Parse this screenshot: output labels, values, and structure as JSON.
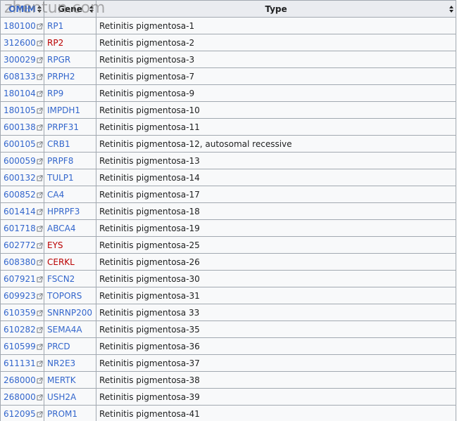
{
  "headers": {
    "omim": "OMIM",
    "gene": "Gene",
    "type": "Type"
  },
  "watermark": "zhentun.com",
  "colors": {
    "link_blue": "#3366cc",
    "link_red": "#ba0000",
    "border": "#a2a9b1",
    "header_bg": "#eaecf0",
    "cell_bg": "#f8f9fa"
  },
  "icons": {
    "sort": "sort-arrows-icon",
    "external": "external-link-icon"
  },
  "rows": [
    {
      "omim": "180100",
      "gene": "RP1",
      "gene_color": "blue",
      "type": "Retinitis pigmentosa-1"
    },
    {
      "omim": "312600",
      "gene": "RP2",
      "gene_color": "red",
      "type": "Retinitis pigmentosa-2"
    },
    {
      "omim": "300029",
      "gene": "RPGR",
      "gene_color": "blue",
      "type": "Retinitis pigmentosa-3"
    },
    {
      "omim": "608133",
      "gene": "PRPH2",
      "gene_color": "blue",
      "type": "Retinitis pigmentosa-7"
    },
    {
      "omim": "180104",
      "gene": "RP9",
      "gene_color": "blue",
      "type": "Retinitis pigmentosa-9"
    },
    {
      "omim": "180105",
      "gene": "IMPDH1",
      "gene_color": "blue",
      "type": "Retinitis pigmentosa-10"
    },
    {
      "omim": "600138",
      "gene": "PRPF31",
      "gene_color": "blue",
      "type": "Retinitis pigmentosa-11"
    },
    {
      "omim": "600105",
      "gene": "CRB1",
      "gene_color": "blue",
      "type": "Retinitis pigmentosa-12, autosomal recessive"
    },
    {
      "omim": "600059",
      "gene": "PRPF8",
      "gene_color": "blue",
      "type": "Retinitis pigmentosa-13"
    },
    {
      "omim": "600132",
      "gene": "TULP1",
      "gene_color": "blue",
      "type": "Retinitis pigmentosa-14"
    },
    {
      "omim": "600852",
      "gene": "CA4",
      "gene_color": "blue",
      "type": "Retinitis pigmentosa-17"
    },
    {
      "omim": "601414",
      "gene": "HPRPF3",
      "gene_color": "blue",
      "type": "Retinitis pigmentosa-18"
    },
    {
      "omim": "601718",
      "gene": "ABCA4",
      "gene_color": "blue",
      "type": "Retinitis pigmentosa-19"
    },
    {
      "omim": "602772",
      "gene": "EYS",
      "gene_color": "red",
      "type": "Retinitis pigmentosa-25"
    },
    {
      "omim": "608380",
      "gene": "CERKL",
      "gene_color": "red",
      "type": "Retinitis pigmentosa-26"
    },
    {
      "omim": "607921",
      "gene": "FSCN2",
      "gene_color": "blue",
      "type": "Retinitis pigmentosa-30"
    },
    {
      "omim": "609923",
      "gene": "TOPORS",
      "gene_color": "blue",
      "type": "Retinitis pigmentosa-31"
    },
    {
      "omim": "610359",
      "gene": "SNRNP200",
      "gene_color": "blue",
      "type": "Retinitis pigmentosa 33"
    },
    {
      "omim": "610282",
      "gene": "SEMA4A",
      "gene_color": "blue",
      "type": "Retinitis pigmentosa-35"
    },
    {
      "omim": "610599",
      "gene": "PRCD",
      "gene_color": "blue",
      "type": "Retinitis pigmentosa-36"
    },
    {
      "omim": "611131",
      "gene": "NR2E3",
      "gene_color": "blue",
      "type": "Retinitis pigmentosa-37"
    },
    {
      "omim": "268000",
      "gene": "MERTK",
      "gene_color": "blue",
      "type": "Retinitis pigmentosa-38"
    },
    {
      "omim": "268000",
      "gene": "USH2A",
      "gene_color": "blue",
      "type": "Retinitis pigmentosa-39"
    },
    {
      "omim": "612095",
      "gene": "PROM1",
      "gene_color": "blue",
      "type": "Retinitis pigmentosa-41"
    }
  ]
}
